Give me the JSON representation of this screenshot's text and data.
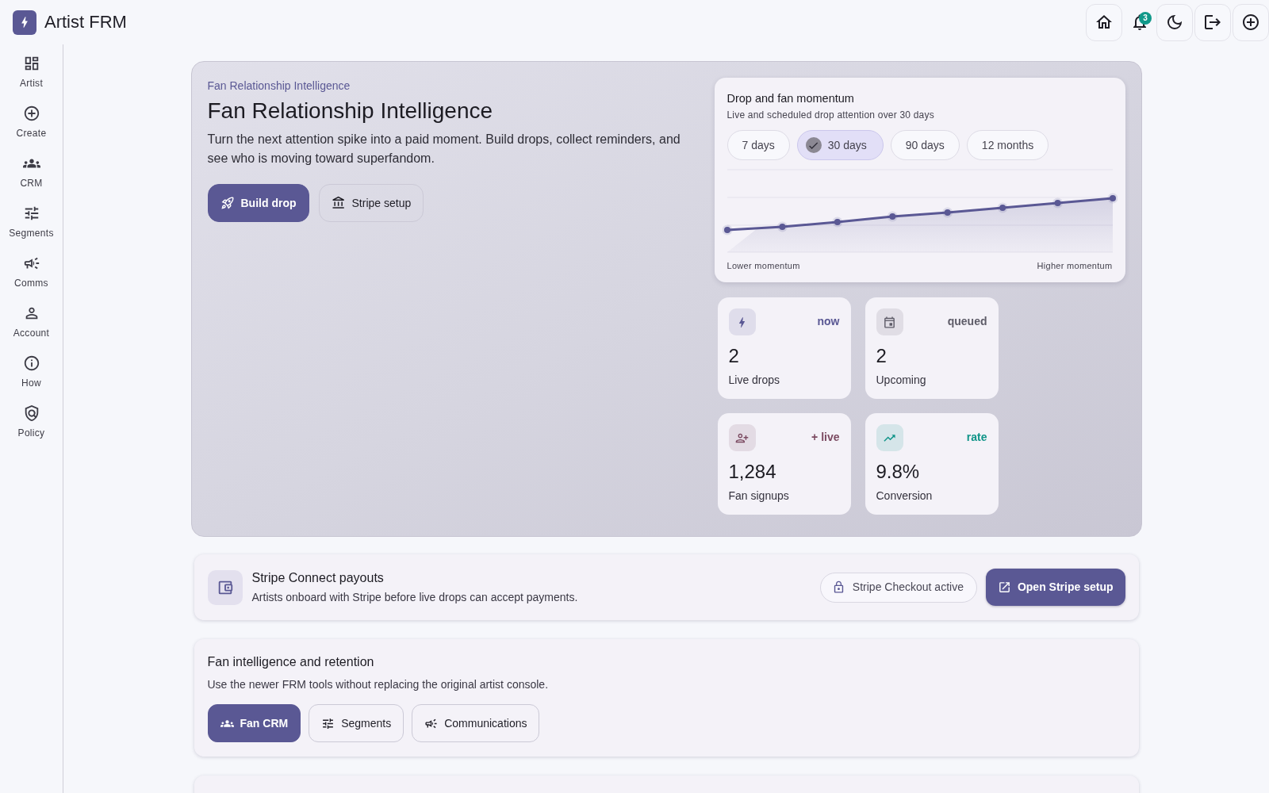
{
  "app": {
    "title": "Artist FRM"
  },
  "toolbar": {
    "notification_count": "3"
  },
  "sidebar": {
    "items": [
      {
        "label": "Artist",
        "selected": false
      },
      {
        "label": "Create",
        "selected": false
      },
      {
        "label": "CRM",
        "selected": false
      },
      {
        "label": "Segments",
        "selected": false
      },
      {
        "label": "Comms",
        "selected": false
      },
      {
        "label": "Account",
        "selected": false
      },
      {
        "label": "How",
        "selected": false
      },
      {
        "label": "Policy",
        "selected": false
      }
    ]
  },
  "hero": {
    "eyebrow": "Fan Relationship Intelligence",
    "title": "Fan Relationship Intelligence",
    "description": "Turn the next attention spike into a paid moment. Build drops, collect reminders, and see who is moving toward superfandom.",
    "buttons": [
      {
        "label": "Build drop",
        "kind": "primary"
      },
      {
        "label": "Stripe setup",
        "kind": "outline"
      }
    ]
  },
  "momentum_card": {
    "title": "Drop and fan momentum",
    "subtitle": "Live and scheduled drop attention over 30 days",
    "ranges": [
      {
        "label": "7 days",
        "selected": false
      },
      {
        "label": "30 days",
        "selected": true
      },
      {
        "label": "90 days",
        "selected": false
      },
      {
        "label": "12 months",
        "selected": false
      }
    ],
    "axis_low": "Lower momentum",
    "axis_high": "Higher momentum"
  },
  "stats": [
    {
      "value": "2",
      "label": "Live drops",
      "tag": "now",
      "color": "#5a5894"
    },
    {
      "value": "2",
      "label": "Upcoming",
      "tag": "queued",
      "color": "#5e5c68"
    },
    {
      "value": "1,284",
      "label": "Fan signups",
      "tag": "+ live",
      "color": "#7b4a61"
    },
    {
      "value": "9.8%",
      "label": "Conversion",
      "tag": "rate",
      "color": "#0f9488"
    }
  ],
  "payouts": {
    "title": "Stripe Connect payouts",
    "description": "Artists onboard with Stripe before live drops can accept payments.",
    "status": "Stripe Checkout active",
    "button": "Open Stripe setup"
  },
  "retention": {
    "title": "Fan intelligence and retention",
    "description": "Use the newer FRM tools without replacing the original artist console.",
    "buttons": [
      {
        "label": "Fan CRM",
        "kind": "primary"
      },
      {
        "label": "Segments",
        "kind": "outline"
      },
      {
        "label": "Communications",
        "kind": "outline"
      }
    ]
  }
}
